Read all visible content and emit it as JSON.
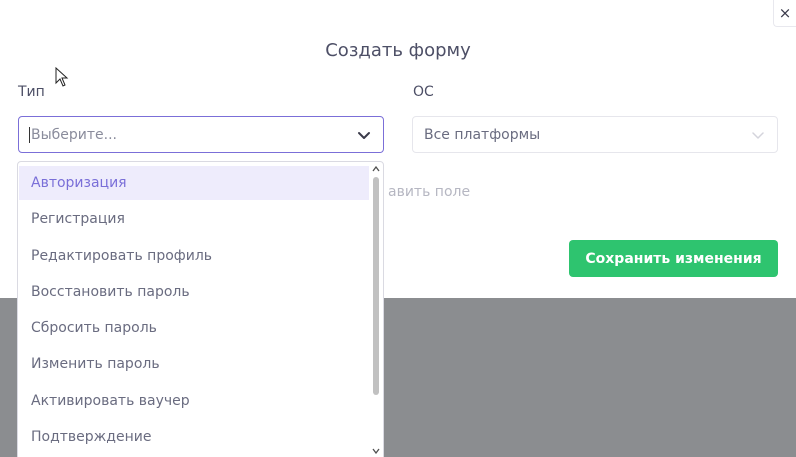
{
  "modal": {
    "title": "Создать форму",
    "close_glyph": "×",
    "close_icon": "close-icon"
  },
  "form": {
    "type_label": "Тип",
    "type_placeholder": "Выберите...",
    "os_label": "ОС",
    "os_value": "Все платформы",
    "add_field_partial": "авить поле",
    "save_label": "Сохранить изменения"
  },
  "dropdown": {
    "options": [
      {
        "label": "Авторизация",
        "active": true
      },
      {
        "label": "Регистрация",
        "active": false
      },
      {
        "label": "Редактировать профиль",
        "active": false
      },
      {
        "label": "Восстановить пароль",
        "active": false
      },
      {
        "label": "Сбросить пароль",
        "active": false
      },
      {
        "label": "Изменить пароль",
        "active": false
      },
      {
        "label": "Активировать ваучер",
        "active": false
      },
      {
        "label": "Подтверждение",
        "active": false
      }
    ]
  },
  "colors": {
    "accent": "#7b6fd8",
    "save_button": "#2ec46f",
    "overlay": "#8b8d90",
    "active_option_bg": "#eeecfc"
  }
}
